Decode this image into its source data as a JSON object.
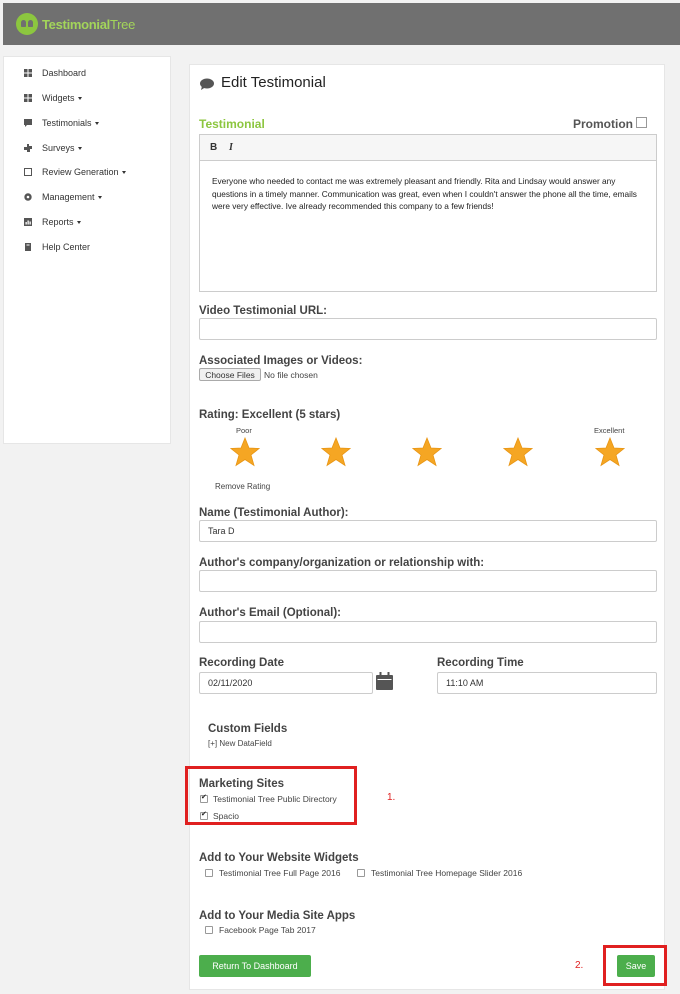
{
  "app": {
    "logo_bold": "Testimonial",
    "logo_light": "Tree"
  },
  "sidebar": {
    "items": [
      {
        "label": "Dashboard",
        "icon": "dashboard-icon",
        "caret": false
      },
      {
        "label": "Widgets",
        "icon": "widgets-icon",
        "caret": true
      },
      {
        "label": "Testimonials",
        "icon": "testimonials-icon",
        "caret": true
      },
      {
        "label": "Surveys",
        "icon": "surveys-icon",
        "caret": true
      },
      {
        "label": "Review Generation",
        "icon": "review-generation-icon",
        "caret": true
      },
      {
        "label": "Management",
        "icon": "management-icon",
        "caret": true
      },
      {
        "label": "Reports",
        "icon": "reports-icon",
        "caret": true
      },
      {
        "label": "Help Center",
        "icon": "help-center-icon",
        "caret": false
      }
    ]
  },
  "page": {
    "title": "Edit Testimonial",
    "testimonial_label": "Testimonial",
    "promotion_label": "Promotion",
    "promotion_checked": false,
    "editor": {
      "bold": "B",
      "italic": "I",
      "text": "Everyone who needed to contact me was extremely pleasant and friendly. Rita and Lindsay would answer any questions in a timely manner. Communication was great, even when I couldn't answer the phone all the time, emails were very effective. Ive already recommended this company to a few friends!"
    },
    "video_url": {
      "label": "Video Testimonial URL:",
      "value": ""
    },
    "images": {
      "label": "Associated Images or Videos:",
      "button": "Choose Files",
      "status": "No file chosen"
    },
    "rating": {
      "label": "Rating: Excellent (5 stars)",
      "poor": "Poor",
      "excellent": "Excellent",
      "value": 5,
      "max": 5,
      "remove": "Remove Rating"
    },
    "name": {
      "label": "Name (Testimonial Author):",
      "value": "Tara D"
    },
    "company": {
      "label": "Author's company/organization or relationship with:",
      "value": ""
    },
    "email": {
      "label": "Author's Email (Optional):",
      "value": ""
    },
    "recording_date": {
      "label": "Recording Date",
      "value": "02/11/2020"
    },
    "recording_time": {
      "label": "Recording Time",
      "value": "11:10 AM"
    },
    "custom_fields": {
      "label": "Custom Fields",
      "new_link": "[+] New DataField"
    },
    "marketing_sites": {
      "label": "Marketing Sites",
      "items": [
        {
          "label": "Testimonial Tree Public Directory",
          "checked": true
        },
        {
          "label": "Spacio",
          "checked": true
        }
      ]
    },
    "website_widgets": {
      "label": "Add to Your Website Widgets",
      "items": [
        {
          "label": "Testimonial Tree Full Page 2016",
          "checked": false
        },
        {
          "label": "Testimonial Tree Homepage Slider 2016",
          "checked": false
        }
      ]
    },
    "media_apps": {
      "label": "Add to Your Media Site Apps",
      "items": [
        {
          "label": "Facebook Page Tab 2017",
          "checked": false
        }
      ]
    },
    "return_button": "Return To Dashboard",
    "save_button": "Save",
    "annotations": {
      "one": "1.",
      "two": "2."
    }
  },
  "colors": {
    "brand_green": "#8cc63f",
    "button_green": "#4cae4c",
    "highlight_red": "#e02020",
    "star": "#f5a623"
  }
}
